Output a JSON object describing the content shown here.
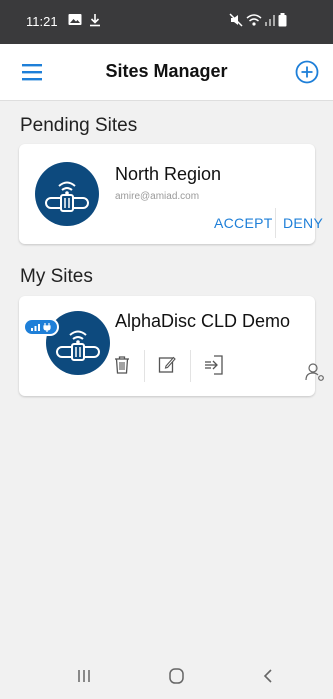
{
  "status_bar": {
    "time": "11:21",
    "icons": [
      "gallery-icon",
      "download-icon",
      "mute-icon",
      "wifi-icon",
      "signal-icon",
      "battery-icon"
    ]
  },
  "header": {
    "title": "Sites Manager",
    "menu_icon": "hamburger-menu-icon",
    "add_icon": "plus-circle-icon"
  },
  "pending": {
    "section_title": "Pending Sites",
    "sites": [
      {
        "name": "North Region",
        "email": "amire@amiad.com",
        "accept_label": "ACCEPT",
        "deny_label": "DENY"
      }
    ]
  },
  "my_sites": {
    "section_title": "My Sites",
    "sites": [
      {
        "name": "AlphaDisc CLD Demo",
        "tools": [
          "trash-icon",
          "edit-icon",
          "login-icon",
          "user-settings-icon"
        ]
      }
    ]
  },
  "colors": {
    "accent": "#1e7fd8",
    "logo_bg": "#0d4a7e",
    "status_bar": "#3a3a3c",
    "page_bg": "#f1f1f1"
  }
}
